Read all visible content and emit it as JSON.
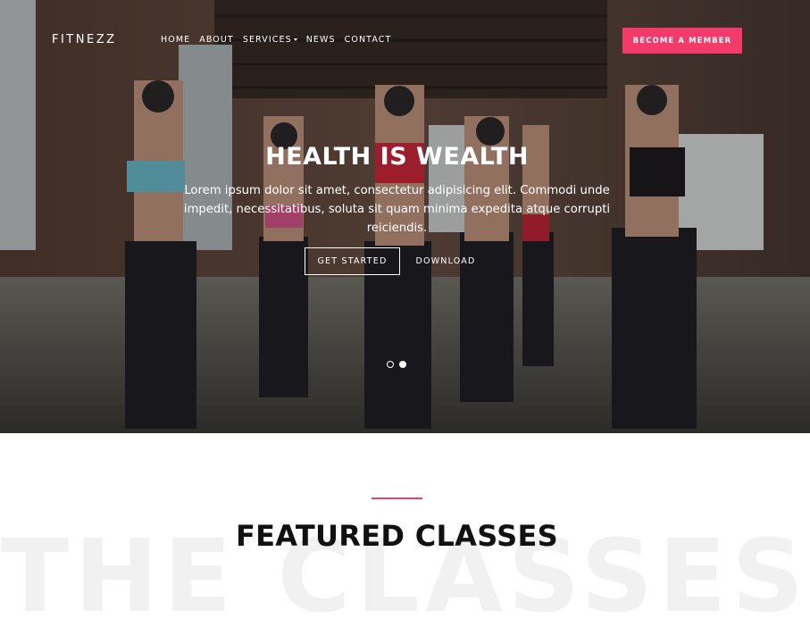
{
  "nav": {
    "brand": "FITNEZZ",
    "items": [
      {
        "label": "HOME"
      },
      {
        "label": "ABOUT"
      },
      {
        "label": "SERVICES"
      },
      {
        "label": "NEWS"
      },
      {
        "label": "CONTACT"
      }
    ],
    "cta": "BECOME A MEMBER"
  },
  "hero": {
    "title": "HEALTH IS WEALTH",
    "text": "Lorem ipsum dolor sit amet, consectetur adipisicing elit. Commodi unde impedit, necessitatibus, soluta sit quam minima expedita atque corrupti reiciendis.",
    "primary_button": "GET STARTED",
    "secondary_button": "DOWNLOAD",
    "slides": 2,
    "active_slide": 2
  },
  "featured": {
    "title": "FEATURED CLASSES",
    "background_word": "THE CLASSES"
  },
  "colors": {
    "accent": "#f23a6b",
    "title": "#111111",
    "watermark": "#f1f1f1"
  }
}
